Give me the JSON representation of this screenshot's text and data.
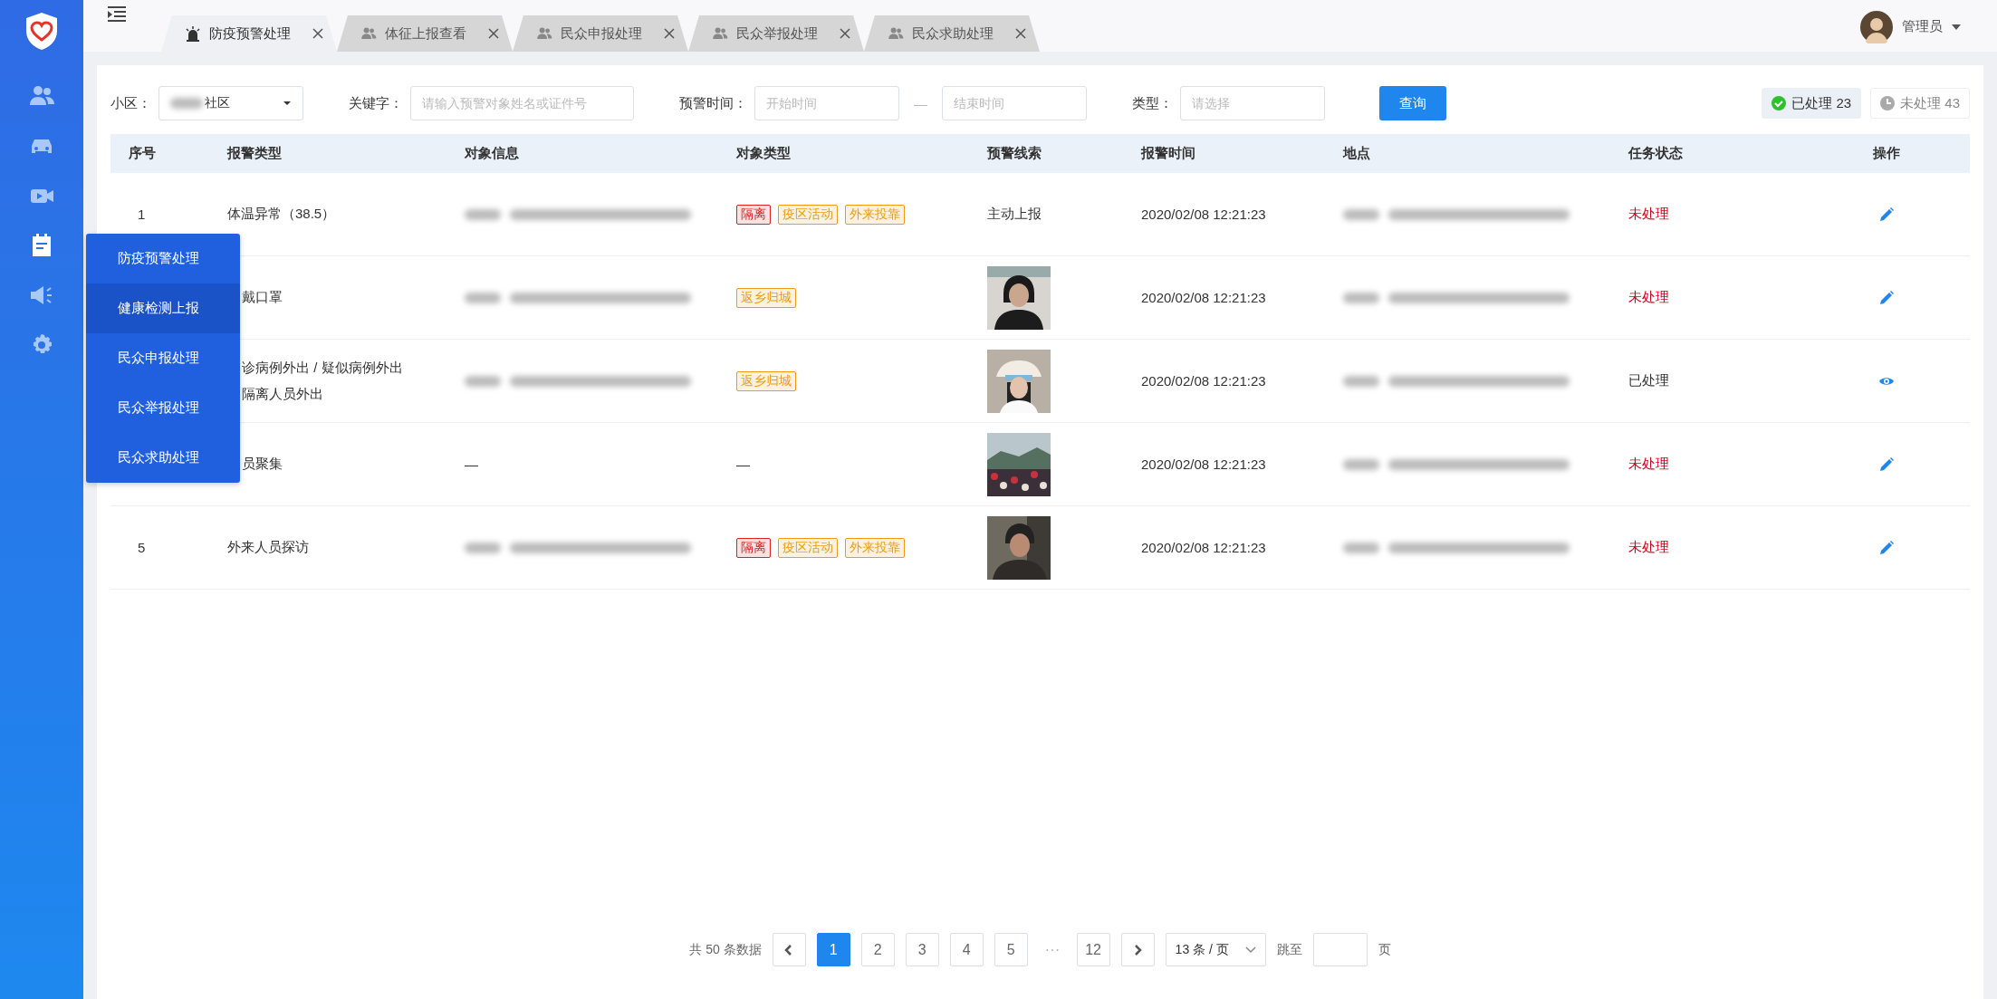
{
  "sidebar": {
    "items": [
      {
        "selected": false
      },
      {
        "selected": false
      },
      {
        "selected": false
      },
      {
        "selected": true
      },
      {
        "selected": false
      },
      {
        "selected": false
      }
    ]
  },
  "flyout_menu": {
    "items": [
      {
        "label": "防疫预警处理",
        "selected": false
      },
      {
        "label": "健康检测上报",
        "selected": true
      },
      {
        "label": "民众申报处理",
        "selected": false
      },
      {
        "label": "民众举报处理",
        "selected": false
      },
      {
        "label": "民众求助处理",
        "selected": false
      }
    ]
  },
  "tabs": [
    {
      "label": "防疫预警处理",
      "selected": true
    },
    {
      "label": "体征上报查看",
      "selected": false
    },
    {
      "label": "民众申报处理",
      "selected": false
    },
    {
      "label": "民众举报处理",
      "selected": false
    },
    {
      "label": "民众求助处理",
      "selected": false
    }
  ],
  "user": {
    "name": "管理员"
  },
  "filters": {
    "community": {
      "label": "小区：",
      "value": "社区",
      "redacted_prefix": true
    },
    "keyword": {
      "label": "关键字：",
      "placeholder": "请输入预警对象姓名或证件号"
    },
    "time": {
      "label": "预警时间：",
      "start_placeholder": "开始时间",
      "separator": "—",
      "end_placeholder": "结束时间"
    },
    "type": {
      "label": "类型：",
      "placeholder": "请选择"
    },
    "search_button": "查询"
  },
  "status_toggles": [
    {
      "label": "已处理",
      "count": "23",
      "selected": true
    },
    {
      "label": "未处理",
      "count": "43",
      "selected": false
    }
  ],
  "table": {
    "columns": [
      "序号",
      "报警类型",
      "对象信息",
      "对象类型",
      "预警线索",
      "报警时间",
      "地点",
      "任务状态",
      "操作"
    ],
    "rows": [
      {
        "index": "1",
        "alarm_type": [
          "体温异常（38.5）"
        ],
        "info": {
          "redacted": true
        },
        "tags": [
          {
            "label": "隔离",
            "color": "#e0201e"
          },
          {
            "label": "疫区活动",
            "color": "#f29a10"
          },
          {
            "label": "外来投靠",
            "color": "#f29a10"
          }
        ],
        "clue": {
          "kind": "text",
          "text": "主动上报"
        },
        "time": "2020/02/08 12:21:23",
        "location": {
          "redacted": true
        },
        "status": {
          "text": "未处理",
          "done": false
        },
        "action": {
          "kind": "edit"
        }
      },
      {
        "alarm_type": [
          "戴口罩"
        ],
        "info": {
          "redacted": true
        },
        "tags": [
          {
            "label": "返乡归城",
            "color": "#f29a10"
          }
        ],
        "clue": {
          "kind": "picture"
        },
        "time": "2020/02/08 12:21:23",
        "location": {
          "redacted": true
        },
        "status": {
          "text": "未处理",
          "done": false
        },
        "action": {
          "kind": "edit"
        }
      },
      {
        "alarm_type": [
          "诊病例外出 / 疑似病例外出",
          "隔离人员外出"
        ],
        "info": {
          "redacted": true
        },
        "tags": [
          {
            "label": "返乡归城",
            "color": "#f29a10"
          }
        ],
        "clue": {
          "kind": "picture"
        },
        "time": "2020/02/08 12:21:23",
        "location": {
          "redacted": true
        },
        "status": {
          "text": "已处理",
          "done": true
        },
        "action": {
          "kind": "view"
        }
      },
      {
        "alarm_type": [
          "员聚集"
        ],
        "info": {
          "text": "—"
        },
        "tags": [],
        "tags_text": "—",
        "clue": {
          "kind": "picture"
        },
        "time": "2020/02/08 12:21:23",
        "location": {
          "redacted": true
        },
        "status": {
          "text": "未处理",
          "done": false
        },
        "action": {
          "kind": "edit"
        }
      },
      {
        "index": "5",
        "alarm_type": [
          "外来人员探访"
        ],
        "info": {
          "redacted": true
        },
        "tags": [
          {
            "label": "隔离",
            "color": "#e0201e"
          },
          {
            "label": "疫区活动",
            "color": "#f29a10"
          },
          {
            "label": "外来投靠",
            "color": "#f29a10"
          }
        ],
        "clue": {
          "kind": "picture"
        },
        "time": "2020/02/08 12:21:23",
        "location": {
          "redacted": true
        },
        "status": {
          "text": "未处理",
          "done": false
        },
        "action": {
          "kind": "edit"
        }
      }
    ]
  },
  "pagination": {
    "total": "共 50 条数据",
    "pages": [
      {
        "label": "1",
        "selected": true
      },
      {
        "label": "2",
        "selected": false
      },
      {
        "label": "3",
        "selected": false
      },
      {
        "label": "4",
        "selected": false
      },
      {
        "label": "5",
        "selected": false
      },
      {
        "label": "12",
        "selected": false
      }
    ],
    "page_size": "13 条 / 页",
    "jump_label": "跳至",
    "jump_suffix": "页"
  }
}
